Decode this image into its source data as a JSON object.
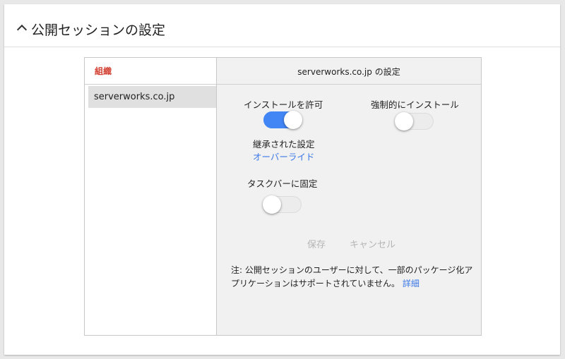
{
  "header": {
    "title": "公開セッションの設定",
    "chevron_icon": "chevron-up-icon"
  },
  "org_panel": {
    "header": "組織",
    "items": [
      {
        "label": "serverworks.co.jp",
        "selected": true
      }
    ]
  },
  "settings_panel": {
    "title": "serverworks.co.jp の設定",
    "allow_install": {
      "label": "インストールを許可",
      "enabled": true,
      "inherited_label": "継承された設定",
      "override_link": "オーバーライド"
    },
    "force_install": {
      "label": "強制的にインストール",
      "enabled": false
    },
    "pin_taskbar": {
      "label": "タスクバーに固定",
      "enabled": false
    },
    "save_label": "保存",
    "cancel_label": "キャンセル",
    "note_text": "注: 公開セッションのユーザーに対して、一部のパッケージ化アプリケーションはサポートされていません。",
    "details_link": "詳細"
  },
  "colors": {
    "accent_blue": "#4285f4",
    "link_blue": "#3b78e7",
    "org_header_red": "#d23f31"
  }
}
